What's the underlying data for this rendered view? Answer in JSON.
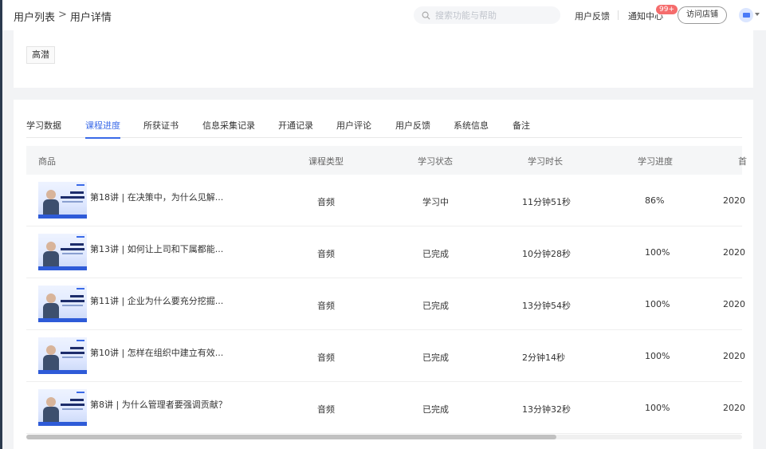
{
  "header": {
    "breadcrumb": [
      "用户列表",
      "用户详情"
    ],
    "breadcrumb_sep": ">",
    "search_placeholder": "搜索功能与帮助",
    "feedback": "用户反馈",
    "notice": "通知中心",
    "notice_badge": "99+",
    "visit_store": "访问店铺"
  },
  "profile": {
    "tag": "高潜"
  },
  "tabs": [
    {
      "label": "学习数据",
      "active": false
    },
    {
      "label": "课程进度",
      "active": true
    },
    {
      "label": "所获证书",
      "active": false
    },
    {
      "label": "信息采集记录",
      "active": false
    },
    {
      "label": "开通记录",
      "active": false
    },
    {
      "label": "用户评论",
      "active": false
    },
    {
      "label": "用户反馈",
      "active": false
    },
    {
      "label": "系统信息",
      "active": false
    },
    {
      "label": "备注",
      "active": false
    }
  ],
  "table": {
    "columns": [
      "商品",
      "课程类型",
      "学习状态",
      "学习时长",
      "学习进度",
      "首"
    ],
    "rows": [
      {
        "title": "第18讲 | 在决策中，为什么见解...",
        "type": "音频",
        "status": "学习中",
        "duration": "11分钟51秒",
        "progress": "86%",
        "date": "2020"
      },
      {
        "title": "第13讲 | 如何让上司和下属都能...",
        "type": "音频",
        "status": "已完成",
        "duration": "10分钟28秒",
        "progress": "100%",
        "date": "2020"
      },
      {
        "title": "第11讲 | 企业为什么要充分挖掘...",
        "type": "音频",
        "status": "已完成",
        "duration": "13分钟54秒",
        "progress": "100%",
        "date": "2020"
      },
      {
        "title": "第10讲 | 怎样在组织中建立有效...",
        "type": "音频",
        "status": "已完成",
        "duration": "2分钟14秒",
        "progress": "100%",
        "date": "2020"
      },
      {
        "title": "第8讲 | 为什么管理者要强调贡献？",
        "type": "音频",
        "status": "已完成",
        "duration": "13分钟32秒",
        "progress": "100%",
        "date": "2020"
      }
    ]
  },
  "scroll": {
    "horizontal_fraction": 0.74
  },
  "colors": {
    "accent": "#3a6ae8",
    "badge": "#f56c6c"
  }
}
